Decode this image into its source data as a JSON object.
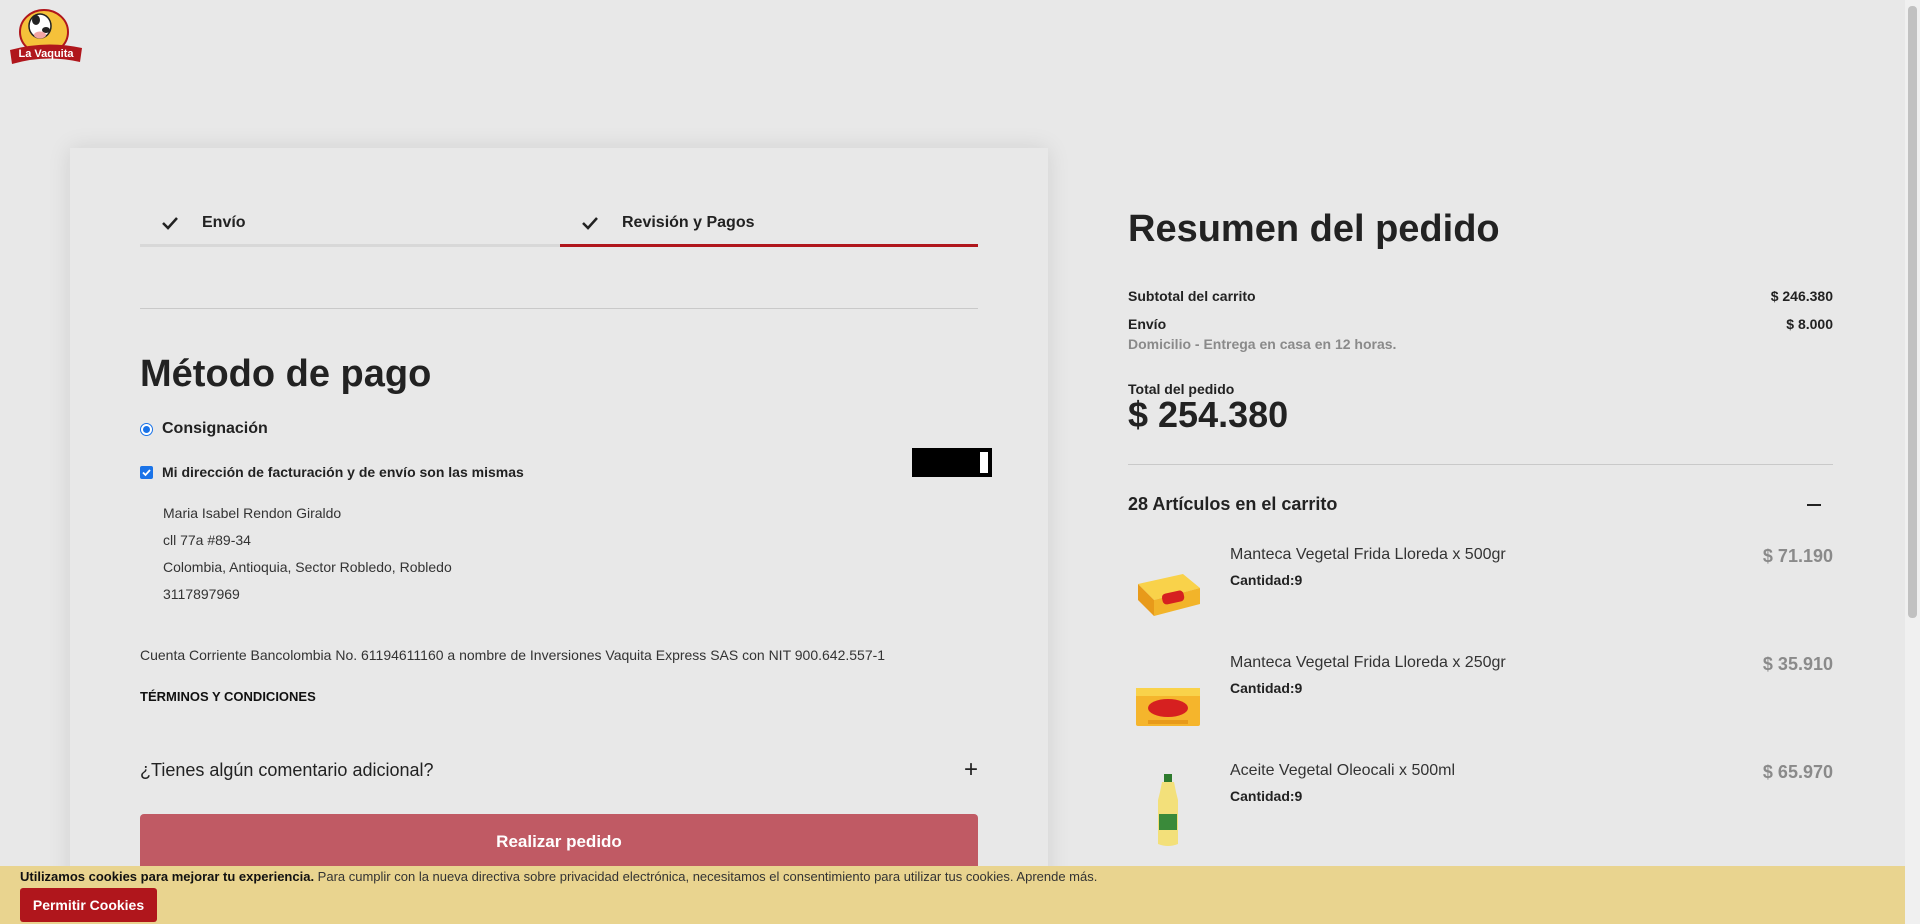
{
  "header": {
    "logo_text": "La Vaquita"
  },
  "steps": [
    {
      "label": "Envío"
    },
    {
      "label": "Revisión y Pagos"
    }
  ],
  "payment": {
    "title": "Método de pago",
    "method_label": "Consignación",
    "same_address_label": "Mi dirección de facturación y de envío son las mismas",
    "address_lines": [
      "Maria Isabel Rendon Giraldo",
      "cll 77a #89-34",
      "Colombia, Antioquia, Sector Robledo, Robledo",
      "3117897969"
    ],
    "bank_info": "Cuenta Corriente Bancolombia No. 61194611160 a nombre de Inversiones Vaquita Express SAS con NIT 900.642.557-1",
    "terms_label": "TÉRMINOS Y CONDICIONES",
    "comment_label": "¿Tienes algún comentario adicional?",
    "order_button": "Realizar pedido"
  },
  "summary": {
    "title": "Resumen del pedido",
    "subtotal_label": "Subtotal del carrito",
    "subtotal_value": "$ 246.380",
    "shipping_label": "Envío",
    "shipping_value": "$ 8.000",
    "shipping_note": "Domicilio - Entrega en casa en 12 horas.",
    "total_label": "Total del pedido",
    "total_value": "$ 254.380",
    "cart_heading": "28 Artículos en el carrito",
    "items": [
      {
        "name": "Manteca Vegetal Frida Lloreda x 500gr",
        "qty": "Cantidad:9",
        "price": "$ 71.190"
      },
      {
        "name": "Manteca Vegetal Frida Lloreda x 250gr",
        "qty": "Cantidad:9",
        "price": "$ 35.910"
      },
      {
        "name": "Aceite Vegetal Oleocali x 500ml",
        "qty": "Cantidad:9",
        "price": "$ 65.970"
      }
    ]
  },
  "cookie": {
    "bold": "Utilizamos cookies para mejorar tu experiencia.",
    "text": " Para cumplir con la nueva directiva sobre privacidad electrónica, necesitamos el consentimiento para utilizar tus cookies. Aprende más.",
    "button": "Permitir Cookies"
  },
  "colors": {
    "brand_red": "#b0161c",
    "order_button": "#c05a64",
    "cookie_bar": "#e9d48f"
  }
}
